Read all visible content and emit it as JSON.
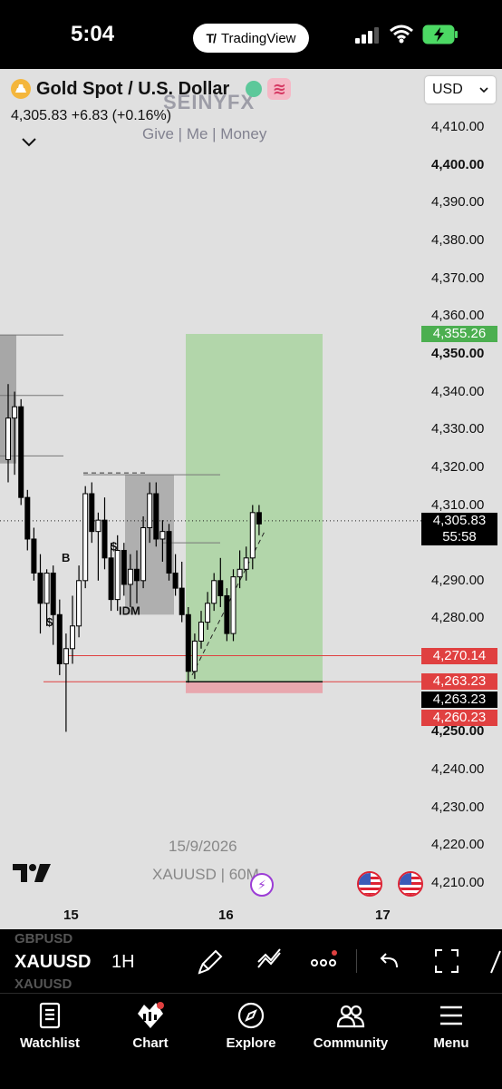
{
  "status_bar": {
    "time": "5:04",
    "app_pill": "TradingView"
  },
  "header": {
    "symbol_title": "Gold Spot / U.S. Dollar",
    "price": "4,305.83",
    "change": "+6.83 (+0.16%)",
    "currency": "USD",
    "icons": [
      "gold-coin-icon",
      "green-status-dot",
      "waves-icon",
      "chevron-down-icon"
    ]
  },
  "watermark": {
    "title": "SEINYFX",
    "subtitle": "Give | Me | Money",
    "date": "15/9/2026",
    "symbol": "XAUUSD | 60M"
  },
  "chart_data": {
    "type": "candlestick",
    "symbol": "XAUUSD",
    "interval": "1H",
    "y_axis": {
      "min": 4205,
      "max": 4415,
      "ticks": [
        "4,410.00",
        "4,400.00",
        "4,390.00",
        "4,380.00",
        "4,370.00",
        "4,360.00",
        "4,350.00",
        "4,340.00",
        "4,330.00",
        "4,320.00",
        "4,310.00",
        "4,290.00",
        "4,280.00",
        "4,250.00",
        "4,240.00",
        "4,230.00",
        "4,220.00",
        "4,210.00"
      ],
      "bold_ticks": [
        "4,400.00",
        "4,350.00",
        "4,250.00"
      ]
    },
    "x_axis": {
      "ticks": [
        "15",
        "16",
        "17"
      ]
    },
    "price_tags": [
      {
        "value": "4,355.26",
        "label": "take-profit",
        "color": "#4caf50"
      },
      {
        "value": "4,305.83",
        "label": "last-price",
        "color": "#000000",
        "countdown": "55:58"
      },
      {
        "value": "4,270.14",
        "label": "line",
        "color": "#e04040"
      },
      {
        "value": "4,263.23",
        "label": "entry-line",
        "color": "#e04040"
      },
      {
        "value": "4,263.23",
        "label": "entry",
        "color": "#000000"
      },
      {
        "value": "4,260.23",
        "label": "stop-loss",
        "color": "#e04040"
      }
    ],
    "annotations": [
      "B",
      "$",
      "IDM",
      "$"
    ],
    "candles": [
      {
        "o": 4322,
        "h": 4342,
        "l": 4316,
        "c": 4333
      },
      {
        "o": 4333,
        "h": 4340,
        "l": 4318,
        "c": 4336
      },
      {
        "o": 4336,
        "h": 4338,
        "l": 4310,
        "c": 4312
      },
      {
        "o": 4312,
        "h": 4314,
        "l": 4298,
        "c": 4301
      },
      {
        "o": 4301,
        "h": 4304,
        "l": 4290,
        "c": 4292
      },
      {
        "o": 4292,
        "h": 4297,
        "l": 4276,
        "c": 4284
      },
      {
        "o": 4284,
        "h": 4293,
        "l": 4278,
        "c": 4292
      },
      {
        "o": 4292,
        "h": 4294,
        "l": 4273,
        "c": 4281
      },
      {
        "o": 4281,
        "h": 4285,
        "l": 4265,
        "c": 4268
      },
      {
        "o": 4268,
        "h": 4276,
        "l": 4250,
        "c": 4272
      },
      {
        "o": 4272,
        "h": 4286,
        "l": 4268,
        "c": 4278
      },
      {
        "o": 4278,
        "h": 4294,
        "l": 4275,
        "c": 4290
      },
      {
        "o": 4290,
        "h": 4315,
        "l": 4288,
        "c": 4313
      },
      {
        "o": 4313,
        "h": 4316,
        "l": 4300,
        "c": 4303
      },
      {
        "o": 4303,
        "h": 4308,
        "l": 4290,
        "c": 4306
      },
      {
        "o": 4306,
        "h": 4312,
        "l": 4293,
        "c": 4296
      },
      {
        "o": 4296,
        "h": 4300,
        "l": 4282,
        "c": 4285
      },
      {
        "o": 4285,
        "h": 4302,
        "l": 4282,
        "c": 4298
      },
      {
        "o": 4298,
        "h": 4300,
        "l": 4286,
        "c": 4289
      },
      {
        "o": 4289,
        "h": 4297,
        "l": 4283,
        "c": 4293
      },
      {
        "o": 4293,
        "h": 4298,
        "l": 4284,
        "c": 4290
      },
      {
        "o": 4290,
        "h": 4307,
        "l": 4288,
        "c": 4304
      },
      {
        "o": 4304,
        "h": 4316,
        "l": 4300,
        "c": 4313
      },
      {
        "o": 4313,
        "h": 4316,
        "l": 4299,
        "c": 4301
      },
      {
        "o": 4301,
        "h": 4306,
        "l": 4295,
        "c": 4303
      },
      {
        "o": 4303,
        "h": 4305,
        "l": 4290,
        "c": 4292
      },
      {
        "o": 4292,
        "h": 4297,
        "l": 4286,
        "c": 4288
      },
      {
        "o": 4288,
        "h": 4295,
        "l": 4279,
        "c": 4281
      },
      {
        "o": 4281,
        "h": 4283,
        "l": 4263,
        "c": 4266
      },
      {
        "o": 4266,
        "h": 4276,
        "l": 4264,
        "c": 4274
      },
      {
        "o": 4274,
        "h": 4282,
        "l": 4272,
        "c": 4279
      },
      {
        "o": 4279,
        "h": 4287,
        "l": 4277,
        "c": 4284
      },
      {
        "o": 4284,
        "h": 4292,
        "l": 4282,
        "c": 4290
      },
      {
        "o": 4290,
        "h": 4296,
        "l": 4283,
        "c": 4286
      },
      {
        "o": 4286,
        "h": 4288,
        "l": 4274,
        "c": 4276
      },
      {
        "o": 4276,
        "h": 4293,
        "l": 4274,
        "c": 4291
      },
      {
        "o": 4291,
        "h": 4298,
        "l": 4288,
        "c": 4293
      },
      {
        "o": 4293,
        "h": 4299,
        "l": 4290,
        "c": 4296
      },
      {
        "o": 4296,
        "h": 4310,
        "l": 4293,
        "c": 4308
      },
      {
        "o": 4308,
        "h": 4310,
        "l": 4302,
        "c": 4305
      }
    ]
  },
  "toolbar": {
    "ghost_top": "GBPUSD",
    "symbol": "XAUUSD",
    "ghost_bottom": "XAUUSD",
    "interval": "1H"
  },
  "tabs": [
    {
      "label": "Watchlist",
      "icon": "watchlist-icon"
    },
    {
      "label": "Chart",
      "icon": "chart-icon"
    },
    {
      "label": "Explore",
      "icon": "compass-icon"
    },
    {
      "label": "Community",
      "icon": "community-icon"
    },
    {
      "label": "Menu",
      "icon": "menu-icon"
    }
  ]
}
